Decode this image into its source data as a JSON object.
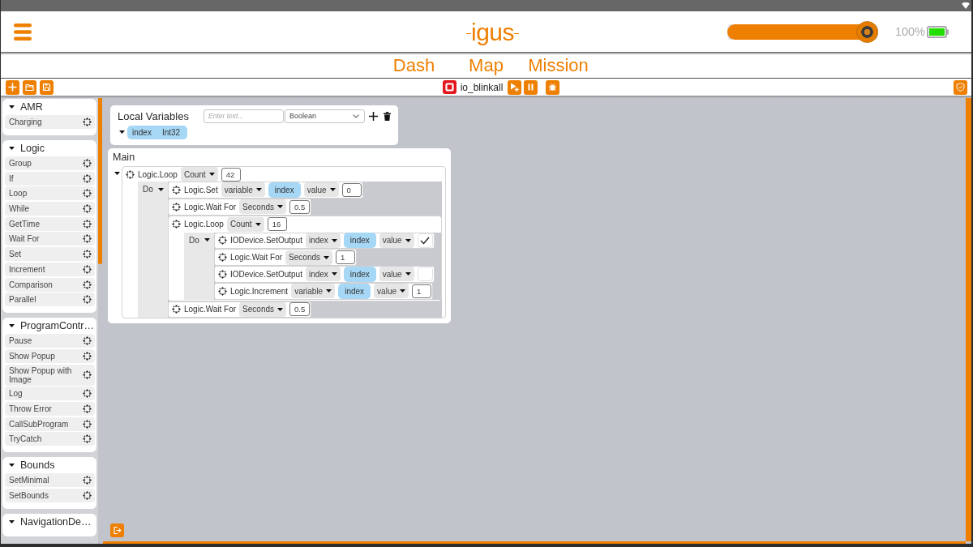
{
  "header": {
    "logo": "igus",
    "speed_slider": {
      "level": 1
    },
    "battery_text": "100%"
  },
  "nav_tabs": [
    {
      "label": "Dash",
      "selected": false
    },
    {
      "label": "Map",
      "selected": false
    },
    {
      "label": "Mission",
      "selected": false
    }
  ],
  "toolbar": {
    "program_name": "io_blinkall"
  },
  "toolbox": [
    {
      "title": "AMR",
      "expanded": true,
      "items": [
        "Charging"
      ]
    },
    {
      "title": "Logic",
      "expanded": true,
      "items": [
        "Group",
        "If",
        "Loop",
        "While",
        "GetTime",
        "Wait For",
        "Set",
        "Increment",
        "Comparison",
        "Parallel"
      ]
    },
    {
      "title": "ProgramContr…",
      "expanded": true,
      "items": [
        "Pause",
        "Show Popup",
        "Show Popup with Image",
        "Log",
        "Throw Error",
        "CallSubProgram",
        "TryCatch"
      ]
    },
    {
      "title": "Bounds",
      "expanded": true,
      "items": [
        "SetMinimal",
        "SetBounds"
      ]
    },
    {
      "title": "NavigationDe…",
      "expanded": true
    }
  ],
  "local_variables": {
    "title": "Local Variables",
    "name_field": {
      "placeholder": "Enter text..."
    },
    "type_select": {
      "value": "Boolean"
    },
    "variables": [
      {
        "name": "index",
        "type": "Int32"
      }
    ]
  },
  "program": {
    "title": "Main",
    "blocks": [
      {
        "kind": "loop",
        "title": "Logic.Loop",
        "expanded": true,
        "params": [
          {
            "kind": "dropdown",
            "label": "Count"
          },
          {
            "kind": "value",
            "value": "42"
          }
        ],
        "body_label": "Do",
        "children": [
          {
            "kind": "statement",
            "title": "Logic.Set",
            "params": [
              {
                "kind": "dropdown",
                "label": "variable"
              },
              {
                "kind": "variable",
                "label": "index"
              },
              {
                "kind": "dropdown",
                "label": "value"
              },
              {
                "kind": "value",
                "value": "0"
              }
            ]
          },
          {
            "kind": "statement",
            "title": "Logic.Wait For",
            "params": [
              {
                "kind": "dropdown",
                "label": "Seconds"
              },
              {
                "kind": "value",
                "value": "0.5"
              }
            ]
          },
          {
            "kind": "loop",
            "title": "Logic.Loop",
            "params": [
              {
                "kind": "dropdown",
                "label": "Count"
              },
              {
                "kind": "value",
                "value": "16"
              }
            ],
            "body_label": "Do",
            "children": [
              {
                "kind": "statement",
                "title": "IODevice.SetOutput",
                "params": [
                  {
                    "kind": "dropdown",
                    "label": "index"
                  },
                  {
                    "kind": "variable",
                    "label": "index"
                  },
                  {
                    "kind": "dropdown",
                    "label": "value"
                  },
                  {
                    "kind": "checkbox",
                    "checked": true
                  }
                ]
              },
              {
                "kind": "statement",
                "title": "Logic.Wait For",
                "params": [
                  {
                    "kind": "dropdown",
                    "label": "Seconds"
                  },
                  {
                    "kind": "value",
                    "value": "1"
                  }
                ]
              },
              {
                "kind": "statement",
                "title": "IODevice.SetOutput",
                "params": [
                  {
                    "kind": "dropdown",
                    "label": "index"
                  },
                  {
                    "kind": "variable",
                    "label": "index"
                  },
                  {
                    "kind": "dropdown",
                    "label": "value"
                  },
                  {
                    "kind": "checkbox",
                    "checked": false
                  }
                ]
              },
              {
                "kind": "statement",
                "title": "Logic.Increment",
                "params": [
                  {
                    "kind": "dropdown",
                    "label": "variable"
                  },
                  {
                    "kind": "variable",
                    "label": "index"
                  },
                  {
                    "kind": "dropdown",
                    "label": "value"
                  },
                  {
                    "kind": "value",
                    "value": "1"
                  }
                ]
              }
            ]
          },
          {
            "kind": "statement",
            "title": "Logic.Wait For",
            "params": [
              {
                "kind": "dropdown",
                "label": "Seconds"
              },
              {
                "kind": "value",
                "value": "0.5"
              }
            ]
          }
        ]
      }
    ]
  }
}
